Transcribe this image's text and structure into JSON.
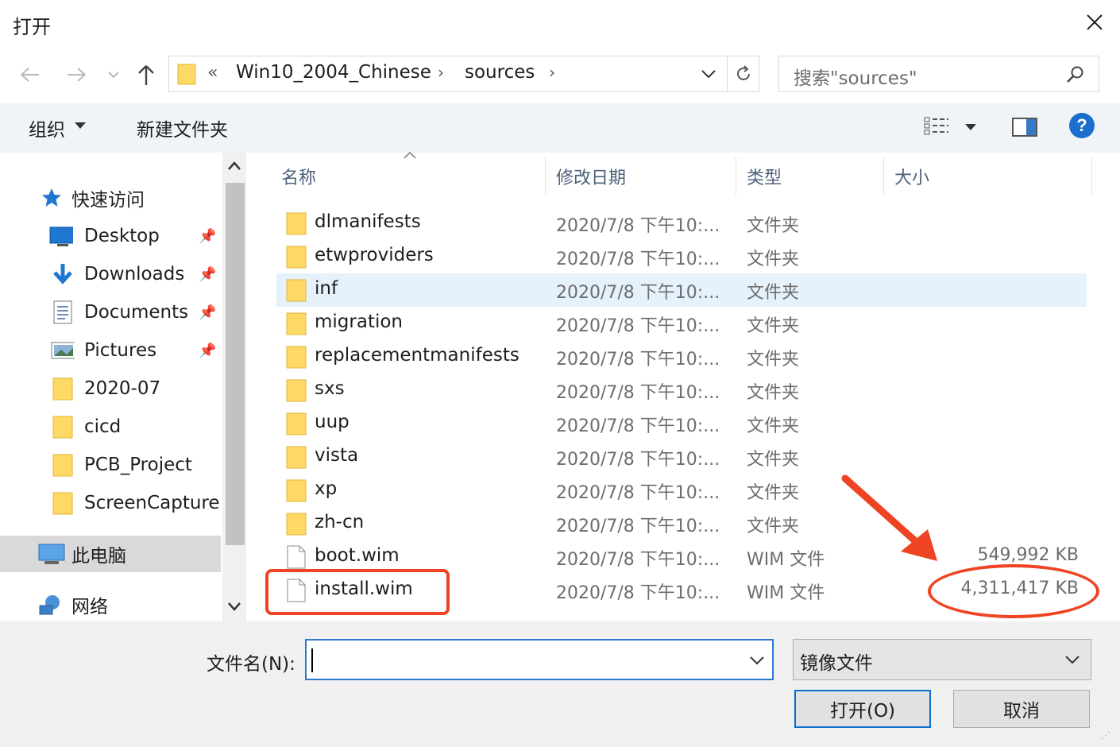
{
  "window": {
    "title": "打开",
    "close_icon": "close-icon"
  },
  "address": {
    "prefix": "«",
    "crumbs": [
      {
        "label": "Win10_2004_Chinese",
        "sep": "›"
      },
      {
        "label": "sources",
        "sep": "›"
      }
    ]
  },
  "search": {
    "placeholder": "搜索\"sources\""
  },
  "toolbar": {
    "organize": "组织",
    "new_folder": "新建文件夹"
  },
  "nav": {
    "quick_access": "快速访问",
    "items": [
      {
        "label": "Desktop",
        "icon": "desktop-icon",
        "pinned": true
      },
      {
        "label": "Downloads",
        "icon": "download-icon",
        "pinned": true
      },
      {
        "label": "Documents",
        "icon": "document-icon",
        "pinned": true
      },
      {
        "label": "Pictures",
        "icon": "pictures-icon",
        "pinned": true
      },
      {
        "label": "2020-07",
        "icon": "folder-icon",
        "pinned": false
      },
      {
        "label": "cicd",
        "icon": "folder-icon",
        "pinned": false
      },
      {
        "label": "PCB_Project",
        "icon": "folder-icon",
        "pinned": false
      },
      {
        "label": "ScreenCapture",
        "icon": "folder-icon",
        "pinned": false
      }
    ],
    "this_pc": "此电脑",
    "network": "网络"
  },
  "columns": {
    "name": "名称",
    "modified": "修改日期",
    "type": "类型",
    "size": "大小"
  },
  "files": [
    {
      "name": "dlmanifests",
      "date": "2020/7/8 下午10:...",
      "type": "文件夹",
      "size": "",
      "kind": "folder"
    },
    {
      "name": "etwproviders",
      "date": "2020/7/8 下午10:...",
      "type": "文件夹",
      "size": "",
      "kind": "folder"
    },
    {
      "name": "inf",
      "date": "2020/7/8 下午10:...",
      "type": "文件夹",
      "size": "",
      "kind": "folder"
    },
    {
      "name": "migration",
      "date": "2020/7/8 下午10:...",
      "type": "文件夹",
      "size": "",
      "kind": "folder"
    },
    {
      "name": "replacementmanifests",
      "date": "2020/7/8 下午10:...",
      "type": "文件夹",
      "size": "",
      "kind": "folder"
    },
    {
      "name": "sxs",
      "date": "2020/7/8 下午10:...",
      "type": "文件夹",
      "size": "",
      "kind": "folder"
    },
    {
      "name": "uup",
      "date": "2020/7/8 下午10:...",
      "type": "文件夹",
      "size": "",
      "kind": "folder"
    },
    {
      "name": "vista",
      "date": "2020/7/8 下午10:...",
      "type": "文件夹",
      "size": "",
      "kind": "folder"
    },
    {
      "name": "xp",
      "date": "2020/7/8 下午10:...",
      "type": "文件夹",
      "size": "",
      "kind": "folder"
    },
    {
      "name": "zh-cn",
      "date": "2020/7/8 下午10:...",
      "type": "文件夹",
      "size": "",
      "kind": "folder"
    },
    {
      "name": "boot.wim",
      "date": "2020/7/8 下午10:...",
      "type": "WIM 文件",
      "size": "549,992 KB",
      "kind": "file"
    },
    {
      "name": "install.wim",
      "date": "2020/7/8 下午10:...",
      "type": "WIM 文件",
      "size": "4,311,417 KB",
      "kind": "file"
    }
  ],
  "hovered_row": "inf",
  "bottom": {
    "filename_label": "文件名(N):",
    "filename_value": "",
    "filetype": "镜像文件",
    "open": "打开(O)",
    "cancel": "取消"
  },
  "colors": {
    "folder": "#ffd966",
    "accent": "#0b6fd0",
    "annotation": "#ef4423",
    "hover": "#e5f1fb"
  }
}
